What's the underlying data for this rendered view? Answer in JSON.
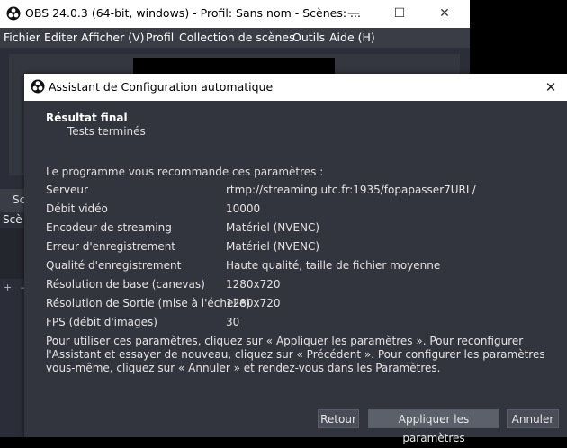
{
  "obs_window": {
    "title": "OBS 24.0.3 (64-bit, windows) - Profil: Sans nom - Scènes: ...",
    "minimize": "—",
    "maximize": "☐",
    "close": "✕",
    "menu": [
      "Fichier",
      "Editer",
      "Afficher (V)",
      "Profil",
      "Collection de scènes",
      "Outils",
      "Aide (H)"
    ],
    "dock_title_fragment": "Sc",
    "scenes_label_fragment": "Scè",
    "scene_buttons": "+ –"
  },
  "dialog": {
    "title": "Assistant de Configuration automatique",
    "close": "✕",
    "section_title": "Résultat final",
    "section_subtitle": "Tests terminés",
    "intro": "Le programme vous recommande ces paramètres :",
    "settings": [
      {
        "key": "Serveur",
        "value": "rtmp://streaming.utc.fr:1935/fopapasser7URL/"
      },
      {
        "key": "Débit vidéo",
        "value": "10000"
      },
      {
        "key": "Encodeur de streaming",
        "value": "Matériel (NVENC)"
      },
      {
        "key": "Erreur d'enregistrement",
        "value": "Matériel (NVENC)"
      },
      {
        "key": "Qualité d'enregistrement",
        "value": "Haute qualité, taille de fichier moyenne"
      },
      {
        "key": "Résolution de base (canevas)",
        "value": "1280x720"
      },
      {
        "key": "Résolution de Sortie (mise à l'échelle)",
        "value": "1280x720"
      },
      {
        "key": "FPS (débit d'images)",
        "value": "30"
      }
    ],
    "footer": "Pour utiliser ces paramètres, cliquez sur « Appliquer les paramètres ». Pour reconfigurer l'Assistant et essayer de nouveau, cliquez sur « Précédent ». Pour configurer les paramètres vous-même, cliquez sur « Annuler » et rendez-vous dans les Paramètres.",
    "buttons": {
      "back": "Retour",
      "apply": "Appliquer les paramètres",
      "cancel": "Annuler"
    }
  }
}
